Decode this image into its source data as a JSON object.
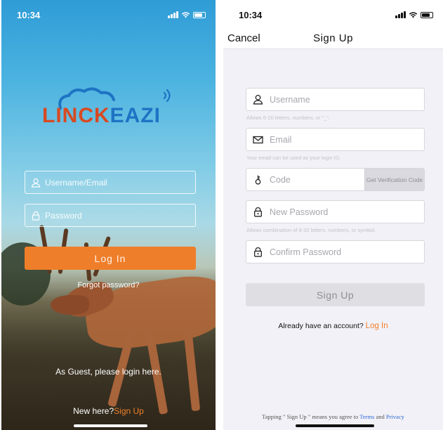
{
  "login_screen": {
    "status": {
      "time": "10:34"
    },
    "logo": {
      "text_left": "LINCK",
      "text_right": "EAZI"
    },
    "username": {
      "placeholder": "Username/Email",
      "icon": "user-icon"
    },
    "password": {
      "placeholder": "Password",
      "icon": "lock-icon"
    },
    "login_button": "Log In",
    "forgot_password": "Forgot password?",
    "guest_text": "As Guest, please login here.",
    "new_here": "New here?",
    "sign_up_link": "Sign Up"
  },
  "signup_screen": {
    "status": {
      "time": "10:34"
    },
    "cancel": "Cancel",
    "title": "Sign  Up",
    "username": {
      "placeholder": "Username",
      "hint": "Allows 6-20 letters, numbers, or \"_\".",
      "icon": "user-icon"
    },
    "email": {
      "placeholder": "Email",
      "hint": "Your email can be used as your login ID.",
      "icon": "envelope-icon"
    },
    "code": {
      "placeholder": "Code",
      "button": "Get Verification Code",
      "icon": "key-icon"
    },
    "new_password": {
      "placeholder": "New Password",
      "hint": "Allows combination of 8-32 letters, numbers, or symbol.",
      "icon": "lock-icon"
    },
    "confirm_password": {
      "placeholder": "Confirm Password",
      "icon": "lock-icon"
    },
    "signup_button": "Sign  Up",
    "already_text": "Already have an account?",
    "login_link": "Log In",
    "terms_text": "Tapping \" Sign Up \" means you agree to",
    "terms_link": "Terms",
    "and": "and",
    "privacy_link": "Privacy"
  },
  "colors": {
    "accent": "#ef7e2a",
    "link_blue": "#2e6bd1",
    "logo_blue": "#1e73c4",
    "logo_red": "#d84a22"
  }
}
